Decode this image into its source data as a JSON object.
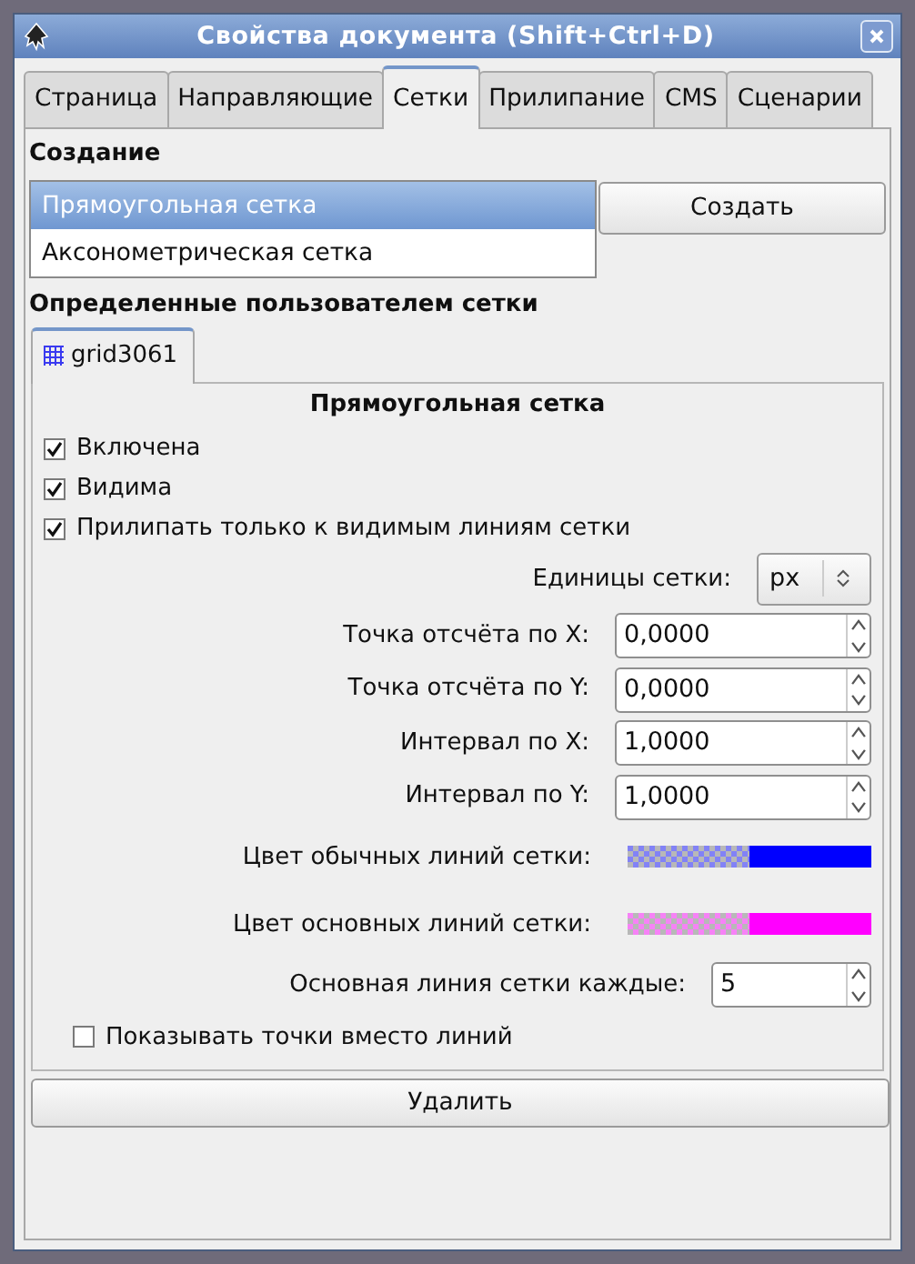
{
  "window": {
    "title": "Свойства документа (Shift+Ctrl+D)"
  },
  "tabs": [
    {
      "label": "Страница",
      "selected": false
    },
    {
      "label": "Направляющие",
      "selected": false
    },
    {
      "label": "Сетки",
      "selected": true
    },
    {
      "label": "Прилипание",
      "selected": false
    },
    {
      "label": "CMS",
      "selected": false
    },
    {
      "label": "Сценарии",
      "selected": false
    }
  ],
  "creation": {
    "heading": "Создание",
    "options": [
      {
        "label": "Прямоугольная сетка",
        "selected": true
      },
      {
        "label": "Аксонометрическая сетка",
        "selected": false
      }
    ],
    "create_button": "Создать"
  },
  "user_grids": {
    "heading": "Определенные пользователем сетки",
    "tabs": [
      {
        "label": "grid3061",
        "selected": true
      }
    ],
    "panel": {
      "title": "Прямоугольная сетка",
      "rows": [
        {
          "kind": "checkbox",
          "label": "Включена",
          "checked": true
        },
        {
          "kind": "checkbox",
          "label": "Видима",
          "checked": true
        },
        {
          "kind": "checkbox",
          "label": "Прилипать только к видимым линиям сетки",
          "checked": true
        },
        {
          "kind": "select",
          "label": "Единицы сетки:",
          "value": "px"
        },
        {
          "kind": "spin",
          "label": "Точка отсчёта по X:",
          "value": "0,0000"
        },
        {
          "kind": "spin",
          "label": "Точка отсчёта по Y:",
          "value": "0,0000"
        },
        {
          "kind": "spin",
          "label": "Интервал по X:",
          "value": "1,0000"
        },
        {
          "kind": "spin",
          "label": "Интервал по Y:",
          "value": "1,0000"
        },
        {
          "kind": "color",
          "label": "Цвет обычных линий сетки:",
          "color": "#0000ff"
        },
        {
          "kind": "color",
          "label": "Цвет основных линий сетки:",
          "color": "#ff00ff"
        },
        {
          "kind": "spin_small",
          "label": "Основная линия сетки каждые:",
          "value": "5"
        },
        {
          "kind": "sub_checkbox",
          "label": "Показывать точки вместо линий",
          "checked": false
        }
      ]
    }
  },
  "delete_button": "Удалить"
}
